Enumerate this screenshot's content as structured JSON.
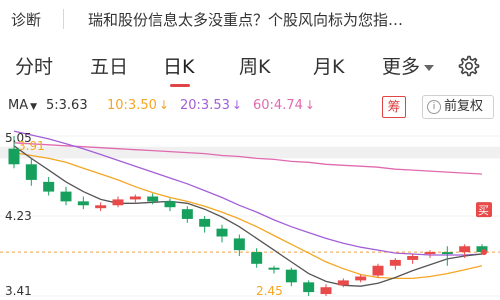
{
  "topbar": {
    "diagnose_label": "诊断",
    "message": "瑞和股份信息太多没重点？个股风向标为您指…"
  },
  "tabs": [
    {
      "label": "分时"
    },
    {
      "label": "五日"
    },
    {
      "label": "日K"
    },
    {
      "label": "周K"
    },
    {
      "label": "月K"
    },
    {
      "label": "更多"
    }
  ],
  "active_tab": "日K",
  "indicators": {
    "ma_label": "MA",
    "ma5": {
      "label": "5:3.63",
      "color": "#333333"
    },
    "ma10": {
      "label": "10:3.50",
      "arrow": "↓",
      "color": "#f5a623"
    },
    "ma20": {
      "label": "20:3.53",
      "arrow": "↓",
      "color": "#a35fd8"
    },
    "ma60": {
      "label": "60:4.74",
      "arrow": "↓",
      "color": "#e06ab0"
    }
  },
  "chou_label": "筹",
  "fuquan_label": "前复权",
  "chart_data": {
    "type": "candlestick",
    "y_tick_labels": [
      "5.05",
      "4.23",
      "3.41"
    ],
    "annotations": [
      "3.91",
      "2.45"
    ],
    "buy_label": "买",
    "up_color": "#e84a4a",
    "down_color": "#17a05d",
    "candles": [
      {
        "o": 4.92,
        "c": 4.76,
        "h": 5.05,
        "l": 4.72
      },
      {
        "o": 4.76,
        "c": 4.6,
        "h": 4.82,
        "l": 4.54
      },
      {
        "o": 4.58,
        "c": 4.48,
        "h": 4.63,
        "l": 4.44
      },
      {
        "o": 4.48,
        "c": 4.38,
        "h": 4.53,
        "l": 4.34
      },
      {
        "o": 4.38,
        "c": 4.34,
        "h": 4.43,
        "l": 4.3
      },
      {
        "o": 4.31,
        "c": 4.34,
        "h": 4.37,
        "l": 4.28
      },
      {
        "o": 4.34,
        "c": 4.4,
        "h": 4.43,
        "l": 4.32
      },
      {
        "o": 4.4,
        "c": 4.43,
        "h": 4.45,
        "l": 4.37
      },
      {
        "o": 4.43,
        "c": 4.38,
        "h": 4.46,
        "l": 4.35
      },
      {
        "o": 4.38,
        "c": 4.32,
        "h": 4.41,
        "l": 4.28
      },
      {
        "o": 4.3,
        "c": 4.2,
        "h": 4.33,
        "l": 4.16
      },
      {
        "o": 4.2,
        "c": 4.12,
        "h": 4.23,
        "l": 4.06
      },
      {
        "o": 4.1,
        "c": 4.02,
        "h": 4.14,
        "l": 3.96
      },
      {
        "o": 4.0,
        "c": 3.88,
        "h": 4.04,
        "l": 3.82
      },
      {
        "o": 3.86,
        "c": 3.74,
        "h": 3.9,
        "l": 3.7
      },
      {
        "o": 3.7,
        "c": 3.68,
        "h": 3.72,
        "l": 3.64
      },
      {
        "o": 3.68,
        "c": 3.55,
        "h": 3.7,
        "l": 3.51
      },
      {
        "o": 3.55,
        "c": 3.45,
        "h": 3.57,
        "l": 3.41
      },
      {
        "o": 3.43,
        "c": 3.5,
        "h": 3.53,
        "l": 3.41
      },
      {
        "o": 3.52,
        "c": 3.57,
        "h": 3.59,
        "l": 3.5
      },
      {
        "o": 3.57,
        "c": 3.61,
        "h": 3.63,
        "l": 3.55
      },
      {
        "o": 3.62,
        "c": 3.72,
        "h": 3.74,
        "l": 3.6
      },
      {
        "o": 3.72,
        "c": 3.78,
        "h": 3.8,
        "l": 3.68
      },
      {
        "o": 3.78,
        "c": 3.82,
        "h": 3.84,
        "l": 3.74
      },
      {
        "o": 3.84,
        "c": 3.86,
        "h": 3.88,
        "l": 3.8
      },
      {
        "o": 3.86,
        "c": 3.84,
        "h": 3.92,
        "l": 3.72
      },
      {
        "o": 3.86,
        "c": 3.92,
        "h": 3.94,
        "l": 3.8
      },
      {
        "o": 3.92,
        "c": 3.86,
        "h": 3.94,
        "l": 3.84
      }
    ],
    "ma5": [
      4.95,
      4.82,
      4.7,
      4.58,
      4.48,
      4.4,
      4.36,
      4.36,
      4.37,
      4.38,
      4.36,
      4.3,
      4.22,
      4.12,
      4.0,
      3.88,
      3.76,
      3.64,
      3.56,
      3.52,
      3.51,
      3.54,
      3.6,
      3.67,
      3.73,
      3.79,
      3.82,
      3.84
    ],
    "ma10": [
      4.88,
      4.85,
      4.82,
      4.78,
      4.72,
      4.66,
      4.6,
      4.53,
      4.47,
      4.42,
      4.38,
      4.33,
      4.27,
      4.2,
      4.12,
      4.03,
      3.94,
      3.85,
      3.76,
      3.69,
      3.63,
      3.6,
      3.59,
      3.59,
      3.61,
      3.64,
      3.68,
      3.72
    ],
    "ma20": [
      5.1,
      5.06,
      5.02,
      4.97,
      4.92,
      4.86,
      4.8,
      4.74,
      4.68,
      4.62,
      4.56,
      4.49,
      4.42,
      4.34,
      4.27,
      4.19,
      4.12,
      4.06,
      4.0,
      3.95,
      3.91,
      3.88,
      3.85,
      3.84,
      3.83,
      3.83,
      3.83,
      3.84
    ],
    "ma60": [
      4.98,
      4.97,
      4.96,
      4.95,
      4.94,
      4.93,
      4.92,
      4.91,
      4.9,
      4.89,
      4.88,
      4.87,
      4.85,
      4.84,
      4.82,
      4.81,
      4.79,
      4.78,
      4.76,
      4.75,
      4.74,
      4.73,
      4.71,
      4.7,
      4.69,
      4.68,
      4.67,
      4.66
    ]
  }
}
